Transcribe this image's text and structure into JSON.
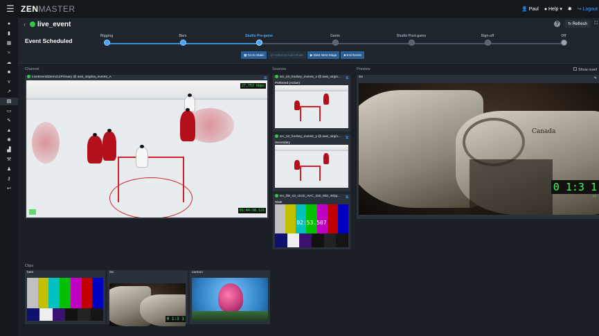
{
  "app": {
    "brand_strong": "ZEN",
    "brand_thin": "MASTER",
    "user": "Paul",
    "help": "Help",
    "logout": "Logout"
  },
  "page": {
    "title": "live_event",
    "refresh_label": "Refresh",
    "status": "Event Scheduled"
  },
  "stages": [
    {
      "label": "Rigging",
      "state": "done"
    },
    {
      "label": "Bars",
      "state": "done"
    },
    {
      "label": "Studio Pre-game",
      "state": "current"
    },
    {
      "label": "Game",
      "state": "pending"
    },
    {
      "label": "Studio Post-game",
      "state": "pending"
    },
    {
      "label": "Sign-off",
      "state": "pending"
    },
    {
      "label": "Off",
      "state": "last"
    }
  ],
  "stage_buttons": {
    "goto_state": "Go to State",
    "auto_mode": "Switch to Auto Mode",
    "next_stage": "Start Next Stage",
    "end_event": "End Event"
  },
  "channel": {
    "section_label": "Channel",
    "name": "LiveEventsDemo12Primary @ aws_virginia_events_A",
    "bitrate": "27,752 kbps",
    "timecode": "01:44:38.121"
  },
  "sources": {
    "section_label": "Sources",
    "items": [
      {
        "name": "src_s3_hockey_events_x @ aws_virgin...",
        "role": "Preferred (Active)"
      },
      {
        "name": "src_s3_hockey_events_y @ aws_virgin...",
        "role": "Secondary"
      },
      {
        "name": "src_file_s3_clock_AVC_420_8bit_49(tp...",
        "role": "Slate",
        "clock": "02:53.507"
      }
    ]
  },
  "preview": {
    "section_label": "Preview",
    "show_overlay_label": "Show overl",
    "source_name": "iss",
    "clock": "0 1:3 1",
    "clock_sub": "9.1",
    "overlay_text": "Canada"
  },
  "clips": {
    "section_label": "Clips",
    "items": [
      {
        "name": "bars"
      },
      {
        "name": "iss",
        "clock": "0 1:3 1"
      },
      {
        "name": "cartoon"
      }
    ]
  },
  "colors": {
    "accent": "#4aa3ff",
    "status_green": "#2ecc40",
    "button_blue": "#2c5f96",
    "smpte": [
      "#c0c0c0",
      "#c0c000",
      "#00c0c0",
      "#00c000",
      "#c000c0",
      "#c00000",
      "#0000c0"
    ]
  },
  "icons": {
    "menu": "hamburger-icon",
    "user": "user-icon",
    "help": "help-circle-icon",
    "settings": "gear-icon",
    "logout": "logout-icon",
    "back": "chevron-left-icon",
    "external": "external-link-icon",
    "refresh": "refresh-icon",
    "fullscreen": "expand-icon"
  }
}
